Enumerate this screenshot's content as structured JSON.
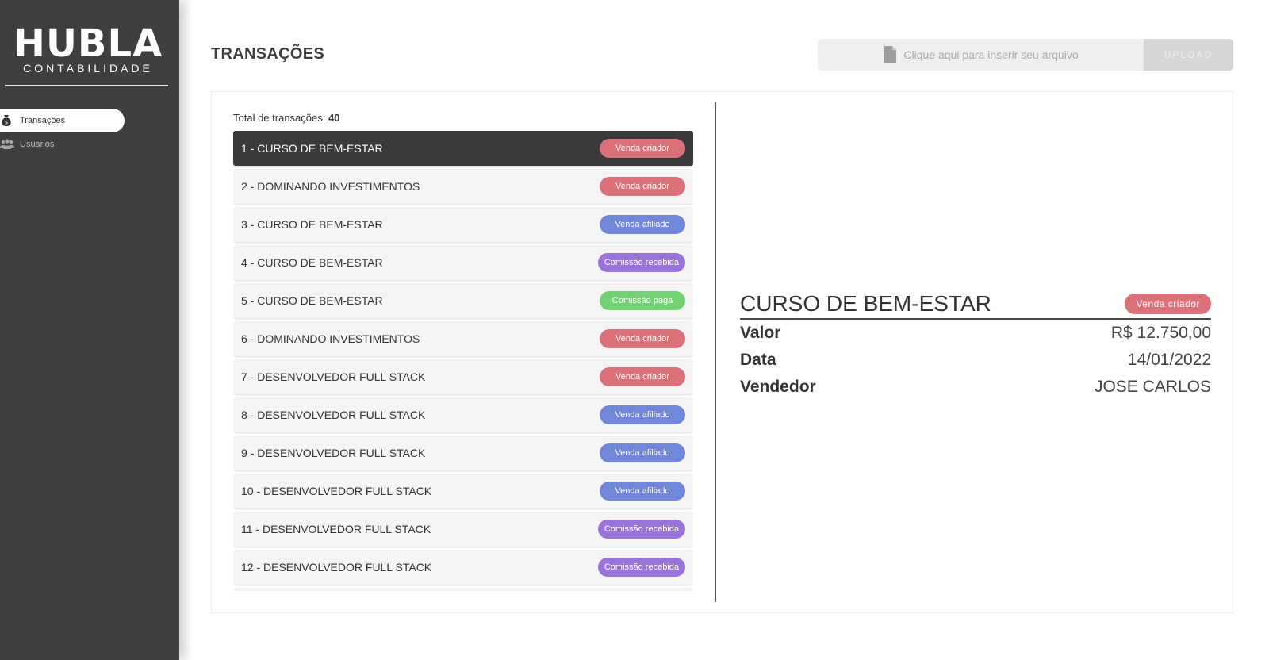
{
  "brand": {
    "logo_main": "HUBLA",
    "logo_sub": "CONTABILIDADE"
  },
  "sidebar": {
    "items": [
      {
        "label": "Transações",
        "icon": "money-bag-icon",
        "active": true
      },
      {
        "label": "Usuarios",
        "icon": "users-icon",
        "active": false
      }
    ]
  },
  "header": {
    "title": "TRANSAÇÕES",
    "upload_placeholder": "Clique aqui para inserir seu arquivo",
    "upload_button": "UPLOAD"
  },
  "list": {
    "total_label": "Total de transações:",
    "total_value": "40",
    "rows": [
      {
        "label": "1 - CURSO DE BEM-ESTAR",
        "badge": "Venda criador",
        "color": "#d9707a",
        "selected": true
      },
      {
        "label": "2 - DOMINANDO INVESTIMENTOS",
        "badge": "Venda criador",
        "color": "#d9707a"
      },
      {
        "label": "3 - CURSO DE BEM-ESTAR",
        "badge": "Venda afiliado",
        "color": "#7187d9"
      },
      {
        "label": "4 - CURSO DE BEM-ESTAR",
        "badge": "Comissão recebida",
        "color": "#9873d9"
      },
      {
        "label": "5 - CURSO DE BEM-ESTAR",
        "badge": "Comissão paga",
        "color": "#72d273"
      },
      {
        "label": "6 - DOMINANDO INVESTIMENTOS",
        "badge": "Venda criador",
        "color": "#d9707a"
      },
      {
        "label": "7 - DESENVOLVEDOR FULL STACK",
        "badge": "Venda criador",
        "color": "#d9707a"
      },
      {
        "label": "8 - DESENVOLVEDOR FULL STACK",
        "badge": "Venda afiliado",
        "color": "#7187d9"
      },
      {
        "label": "9 - DESENVOLVEDOR FULL STACK",
        "badge": "Venda afiliado",
        "color": "#7187d9"
      },
      {
        "label": "10 - DESENVOLVEDOR FULL STACK",
        "badge": "Venda afiliado",
        "color": "#7187d9"
      },
      {
        "label": "11 - DESENVOLVEDOR FULL STACK",
        "badge": "Comissão recebida",
        "color": "#9873d9"
      },
      {
        "label": "12 - DESENVOLVEDOR FULL STACK",
        "badge": "Comissão recebida",
        "color": "#9873d9"
      },
      {
        "label": "",
        "badge": "",
        "color": "#d9707a"
      }
    ]
  },
  "detail": {
    "title": "CURSO DE BEM-ESTAR",
    "badge": "Venda criador",
    "fields": [
      {
        "key": "Valor",
        "value": "R$ 12.750,00"
      },
      {
        "key": "Data",
        "value": "14/01/2022"
      },
      {
        "key": "Vendedor",
        "value": "JOSE CARLOS"
      }
    ]
  }
}
